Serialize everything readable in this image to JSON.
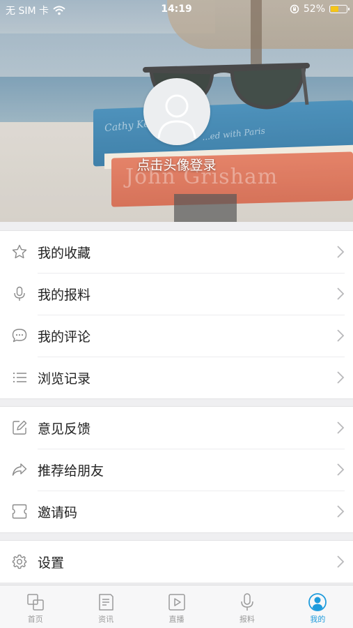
{
  "status_bar": {
    "carrier": "无 SIM 卡",
    "time": "14:19",
    "battery": "52%",
    "battery_level": 0.52
  },
  "header": {
    "login_prompt": "点击头像登录",
    "cover_text": {
      "book1": "Cathy Kelly",
      "book1_sub": "...ed with Paris",
      "book2": "John Grisham"
    }
  },
  "menu": {
    "group1": [
      {
        "label": "我的收藏",
        "icon": "star-icon"
      },
      {
        "label": "我的报料",
        "icon": "microphone-icon"
      },
      {
        "label": "我的评论",
        "icon": "comment-icon"
      },
      {
        "label": "浏览记录",
        "icon": "list-icon"
      }
    ],
    "group2": [
      {
        "label": "意见反馈",
        "icon": "edit-icon"
      },
      {
        "label": "推荐给朋友",
        "icon": "share-icon"
      },
      {
        "label": "邀请码",
        "icon": "ticket-icon"
      }
    ],
    "group3": [
      {
        "label": "设置",
        "icon": "gear-icon"
      }
    ]
  },
  "tabbar": {
    "tabs": [
      {
        "label": "首页",
        "icon": "home-squares-icon",
        "active": false
      },
      {
        "label": "资讯",
        "icon": "news-icon",
        "active": false
      },
      {
        "label": "直播",
        "icon": "play-icon",
        "active": false
      },
      {
        "label": "报料",
        "icon": "microphone-icon",
        "active": false
      },
      {
        "label": "我的",
        "icon": "user-icon",
        "active": true
      }
    ]
  },
  "colors": {
    "accent": "#1e9bdc",
    "inactive": "#9a9a9a",
    "battery": "#f5c518"
  }
}
